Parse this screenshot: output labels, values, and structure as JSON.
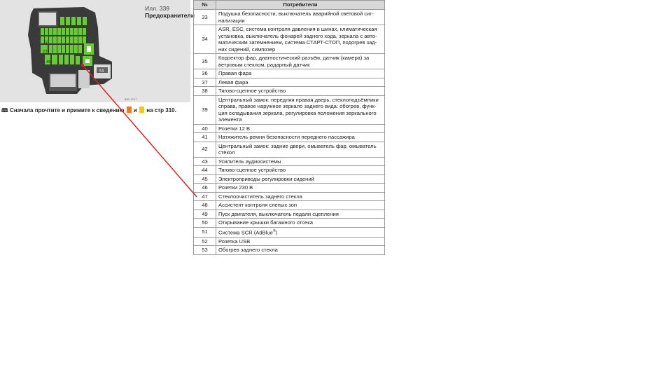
{
  "illustration": {
    "number": "Илл. 339",
    "title": "Предохранители",
    "fuse_labels": [
      "22",
      "23",
      "45",
      "53"
    ],
    "corner_code": "BML-1157"
  },
  "note": {
    "prefix": "Сначала прочтите и примите к сведению",
    "and": "и",
    "suffix": "на стр 310."
  },
  "table": {
    "headers": [
      "№",
      "Потребители"
    ],
    "rows": [
      {
        "n": "33",
        "text": "Подушка безопасности, выключатель аварийной световой сиг-нализации"
      },
      {
        "n": "34",
        "text": "ASR, ESC, система контроля давления в шинах, климатическая установка, выключатель фонарей заднего хода, зеркала с авто-матическим затемнением, система СТАРТ-СТОП, подогрев зад-них сидений, симпозер"
      },
      {
        "n": "35",
        "text": "Корректор фар, диагностический разъём, датчик (камера) за ветровым стеклом, радарный датчик"
      },
      {
        "n": "36",
        "text": "Правая фара"
      },
      {
        "n": "37",
        "text": "Левая фара"
      },
      {
        "n": "38",
        "text": "Тягово-сцепное устройство"
      },
      {
        "n": "39",
        "text": "Центральный замок: передняя правая дверь, стеклоподъёмники справа, правое наружное зеркало заднего вида: обогрев, функ-ция складывания зеркала, регулировка положения зеркального элемента"
      },
      {
        "n": "40",
        "text": "Розетки 12 В"
      },
      {
        "n": "41",
        "text": "Натяжитель ремня безопасности переднего пассажира"
      },
      {
        "n": "42",
        "text": "Центральный замок: задние двери, омыватель фар, омыватель стёкол"
      },
      {
        "n": "43",
        "text": "Усилитель аудиосистемы"
      },
      {
        "n": "44",
        "text": "Тягово-сцепное устройство"
      },
      {
        "n": "45",
        "text": "Электроприводы регулировки сидений"
      },
      {
        "n": "46",
        "text": "Розетки 230 В"
      },
      {
        "n": "47",
        "text": "Стеклоочиститель заднего стекла"
      },
      {
        "n": "48",
        "text": "Ассистент контроля слепых зон"
      },
      {
        "n": "49",
        "text": "Пуск двигателя, выключатель педали сцепления"
      },
      {
        "n": "50",
        "text": "Открывание крышки багажного отсека"
      },
      {
        "n": "51",
        "text": "Система SCR (AdBlue",
        "sup": "®",
        "after": ")"
      },
      {
        "n": "52",
        "text": "Розетка USB"
      },
      {
        "n": "53",
        "text": "Обогрев заднего стекла"
      }
    ]
  },
  "colors": {
    "fuse_green": "#66cc33",
    "pointer_red": "#e02020",
    "panel_gray": "#e3e3e3"
  }
}
